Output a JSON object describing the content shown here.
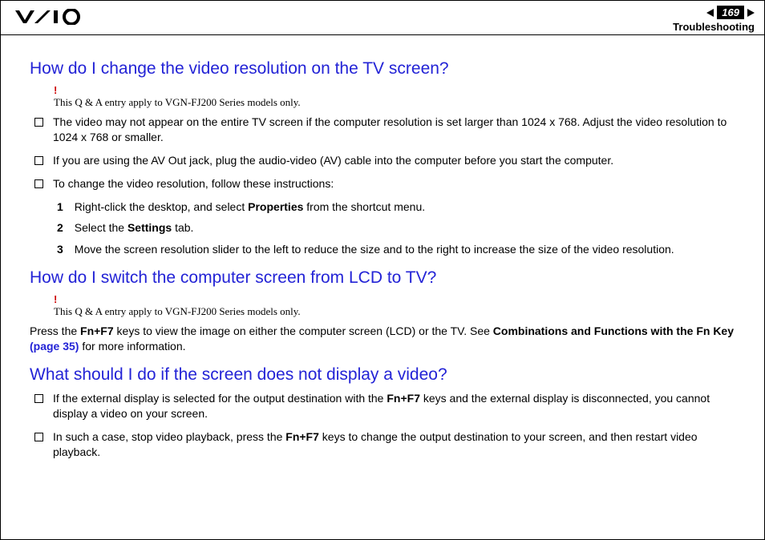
{
  "header": {
    "page_number": "169",
    "section": "Troubleshooting"
  },
  "q1": {
    "heading": "How do I change the video resolution on the TV screen?",
    "bang": "!",
    "note": "This Q & A entry apply to VGN-FJ200 Series models only.",
    "b1": "The video may not appear on the entire TV screen if the computer resolution is set larger than 1024 x 768. Adjust the video resolution to 1024 x 768 or smaller.",
    "b2": "If you are using the AV Out jack, plug the audio-video (AV) cable into the computer before you start the computer.",
    "b3": "To change the video resolution, follow these instructions:",
    "n1": "1",
    "s1a": "Right-click the desktop, and select ",
    "s1b": "Properties",
    "s1c": " from the shortcut menu.",
    "n2": "2",
    "s2a": "Select the ",
    "s2b": "Settings",
    "s2c": " tab.",
    "n3": "3",
    "s3": "Move the screen resolution slider to the left to reduce the size and to the right to increase the size of the video resolution."
  },
  "q2": {
    "heading": "How do I switch the computer screen from LCD to TV?",
    "bang": "!",
    "note": "This Q & A entry apply to VGN-FJ200 Series models only.",
    "p1a": "Press the ",
    "p1b": "Fn+F7",
    "p1c": " keys to view the image on either the computer screen (LCD) or the TV. See ",
    "p1d": "Combinations and Functions with the Fn Key ",
    "p1e": "(page 35)",
    "p1f": " for more information."
  },
  "q3": {
    "heading": "What should I do if the screen does not display a video?",
    "b1a": "If the external display is selected for the output destination with the ",
    "b1b": "Fn+F7",
    "b1c": " keys and the external display is disconnected, you cannot display a video on your screen.",
    "b2a": "In such a case, stop video playback, press the ",
    "b2b": "Fn+F7",
    "b2c": " keys to change the output destination to your screen, and then restart video playback."
  }
}
